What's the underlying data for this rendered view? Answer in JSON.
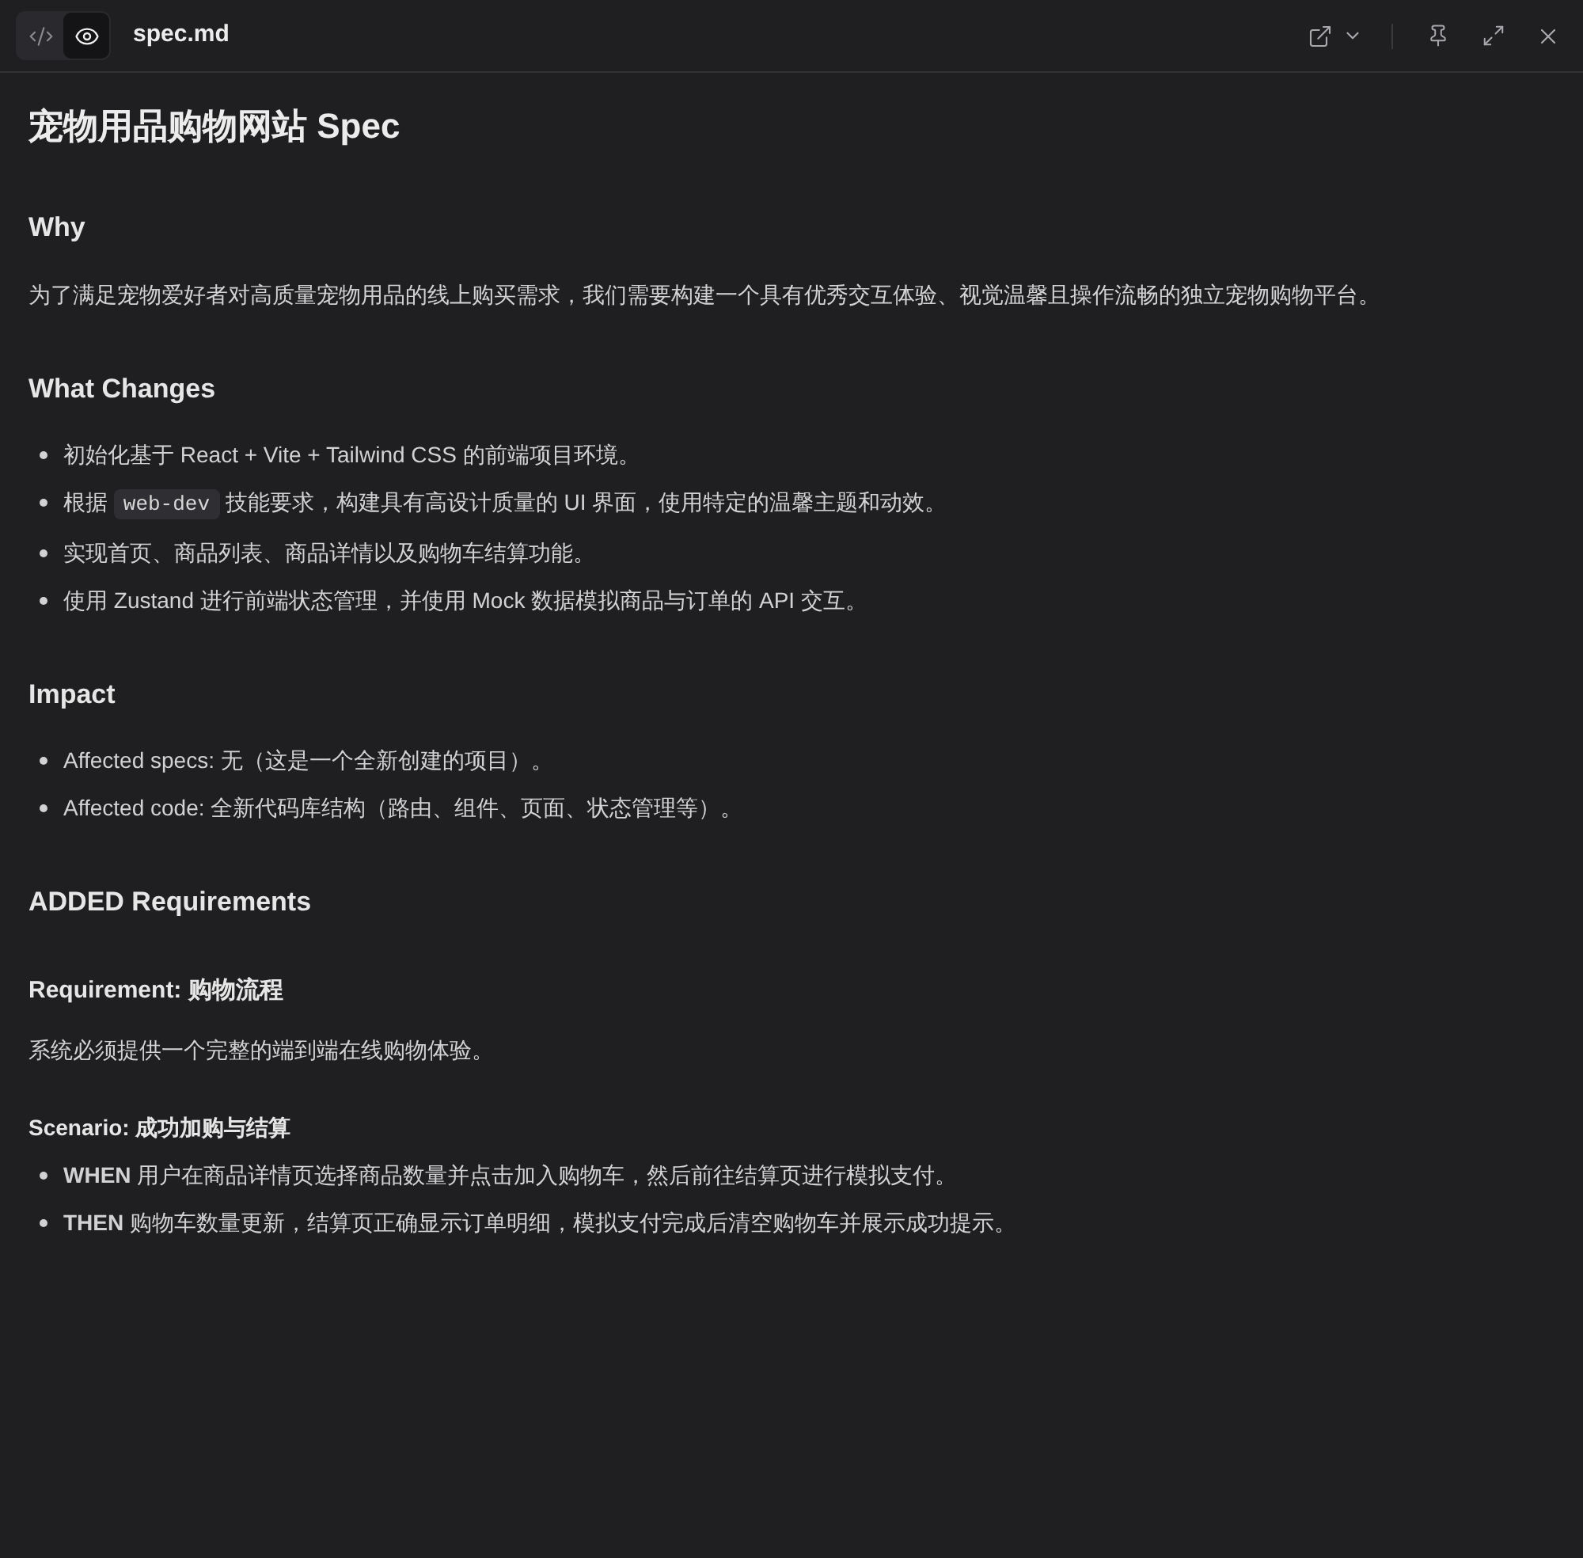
{
  "toolbar": {
    "view_toggle": [
      {
        "kind": "code",
        "selected": false
      },
      {
        "kind": "preview",
        "selected": true
      }
    ],
    "filename": "spec.md"
  },
  "document": [
    {
      "kind": "h1",
      "text": "宠物用品购物网站 Spec"
    },
    {
      "kind": "h2",
      "text": "Why"
    },
    {
      "kind": "p",
      "text": "为了满足宠物爱好者对高质量宠物用品的线上购买需求，我们需要构建一个具有优秀交互体验、视觉温馨且操作流畅的独立宠物购物平台。"
    },
    {
      "kind": "h2",
      "text": "What Changes"
    },
    {
      "kind": "ul",
      "items": [
        [
          {
            "kind": "text",
            "text": "初始化基于 React + Vite + Tailwind CSS 的前端项目环境。"
          }
        ],
        [
          {
            "kind": "text",
            "text": "根据 "
          },
          {
            "kind": "code",
            "text": "web-dev"
          },
          {
            "kind": "text",
            "text": " 技能要求，构建具有高设计质量的 UI 界面，使用特定的温馨主题和动效。"
          }
        ],
        [
          {
            "kind": "text",
            "text": "实现首页、商品列表、商品详情以及购物车结算功能。"
          }
        ],
        [
          {
            "kind": "text",
            "text": "使用 Zustand 进行前端状态管理，并使用 Mock 数据模拟商品与订单的 API 交互。"
          }
        ]
      ]
    },
    {
      "kind": "h2",
      "text": "Impact"
    },
    {
      "kind": "ul",
      "items": [
        [
          {
            "kind": "text",
            "text": "Affected specs: 无（这是一个全新创建的项目）。"
          }
        ],
        [
          {
            "kind": "text",
            "text": "Affected code: 全新代码库结构（路由、组件、页面、状态管理等）。"
          }
        ]
      ]
    },
    {
      "kind": "h2",
      "text": "ADDED Requirements"
    },
    {
      "kind": "h3",
      "text": "Requirement: 购物流程"
    },
    {
      "kind": "p",
      "text": "系统必须提供一个完整的端到端在线购物体验。"
    },
    {
      "kind": "h4",
      "text": "Scenario: 成功加购与结算"
    },
    {
      "kind": "ul",
      "items": [
        [
          {
            "kind": "text",
            "text": "**WHEN** 用户在商品详情页选择商品数量并点击加入购物车，然后前往结算页进行模拟支付。"
          }
        ],
        [
          {
            "kind": "text",
            "text": "**THEN** 购物车数量更新，结算页正确显示订单明细，模拟支付完成后清空购物车并展示成功提示。"
          }
        ]
      ]
    }
  ]
}
